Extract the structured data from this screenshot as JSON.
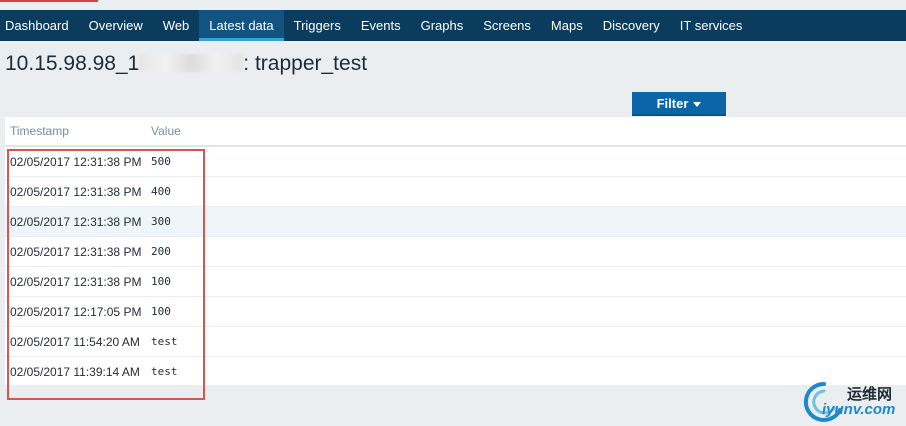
{
  "nav": {
    "items": [
      {
        "label": "Dashboard",
        "active": false
      },
      {
        "label": "Overview",
        "active": false
      },
      {
        "label": "Web",
        "active": false
      },
      {
        "label": "Latest data",
        "active": true
      },
      {
        "label": "Triggers",
        "active": false
      },
      {
        "label": "Events",
        "active": false
      },
      {
        "label": "Graphs",
        "active": false
      },
      {
        "label": "Screens",
        "active": false
      },
      {
        "label": "Maps",
        "active": false
      },
      {
        "label": "Discovery",
        "active": false
      },
      {
        "label": "IT services",
        "active": false
      }
    ]
  },
  "page": {
    "title_prefix": "10.15.98.98_1",
    "title_suffix": ": trapper_test"
  },
  "filter": {
    "label": "Filter"
  },
  "table": {
    "columns": [
      "Timestamp",
      "Value"
    ],
    "rows": [
      {
        "timestamp": "02/05/2017 12:31:38 PM",
        "value": "500"
      },
      {
        "timestamp": "02/05/2017 12:31:38 PM",
        "value": "400"
      },
      {
        "timestamp": "02/05/2017 12:31:38 PM",
        "value": "300"
      },
      {
        "timestamp": "02/05/2017 12:31:38 PM",
        "value": "200"
      },
      {
        "timestamp": "02/05/2017 12:31:38 PM",
        "value": "100"
      },
      {
        "timestamp": "02/05/2017 12:17:05 PM",
        "value": "100"
      },
      {
        "timestamp": "02/05/2017 11:54:20 AM",
        "value": "test"
      },
      {
        "timestamp": "02/05/2017 11:39:14 AM",
        "value": "test"
      }
    ]
  },
  "watermark": {
    "cn": "运维网",
    "en": "iyunv.com"
  },
  "colors": {
    "nav_bg": "#0b3c5d",
    "nav_active": "#115381",
    "button": "#0a66a6",
    "highlight_box": "#d9534f"
  }
}
